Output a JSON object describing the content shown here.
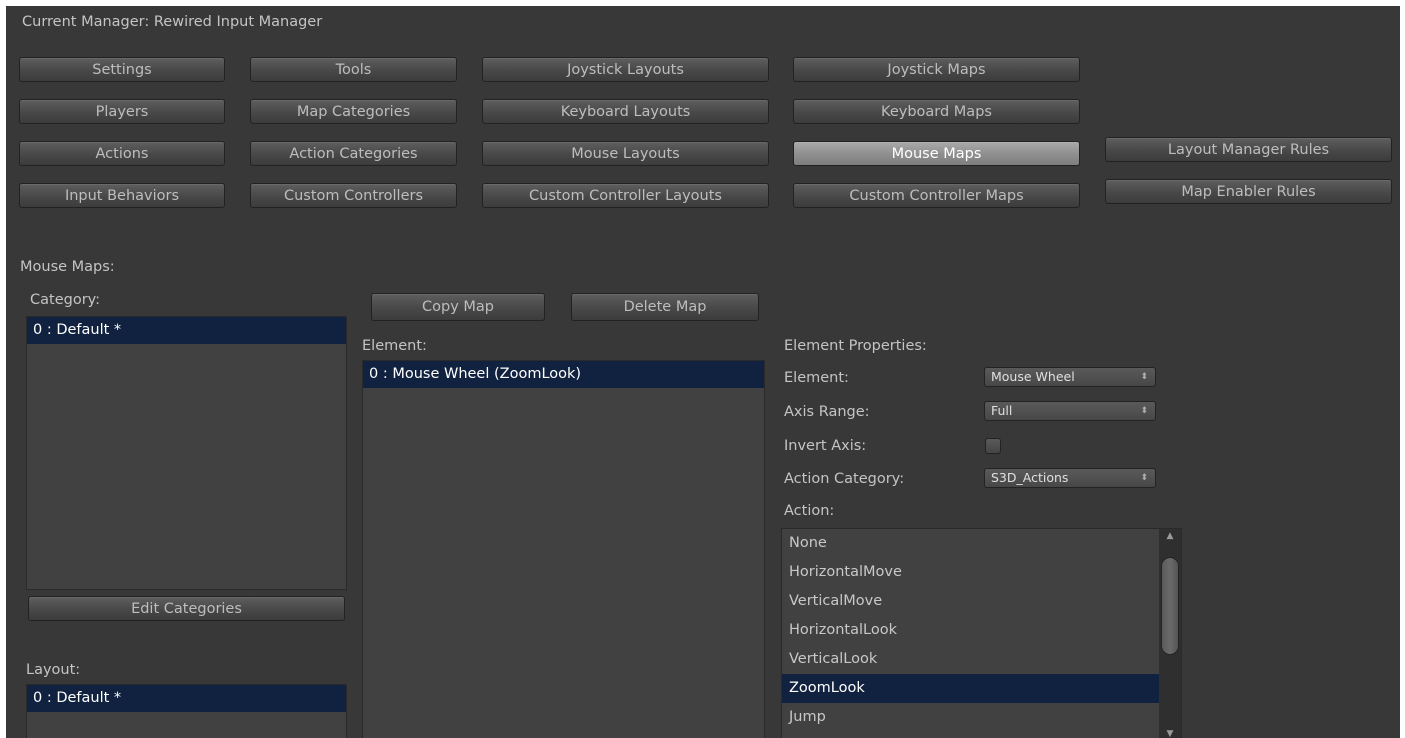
{
  "header": {
    "current_manager": "Current Manager: Rewired Input Manager"
  },
  "nav": {
    "settings": "Settings",
    "tools": "Tools",
    "joystick_layouts": "Joystick Layouts",
    "joystick_maps": "Joystick Maps",
    "players": "Players",
    "map_categories": "Map Categories",
    "keyboard_layouts": "Keyboard Layouts",
    "keyboard_maps": "Keyboard Maps",
    "actions": "Actions",
    "action_categories": "Action Categories",
    "mouse_layouts": "Mouse Layouts",
    "mouse_maps": "Mouse Maps",
    "layout_manager_rules": "Layout Manager Rules",
    "input_behaviors": "Input Behaviors",
    "custom_controllers": "Custom Controllers",
    "custom_controller_layouts": "Custom Controller Layouts",
    "custom_controller_maps": "Custom Controller Maps",
    "map_enabler_rules": "Map Enabler Rules"
  },
  "section_title": "Mouse Maps:",
  "category": {
    "label": "Category:",
    "items": [
      "0 : Default *"
    ],
    "edit_button": "Edit Categories"
  },
  "layout": {
    "label": "Layout:",
    "items": [
      "0 : Default *"
    ]
  },
  "map_buttons": {
    "copy": "Copy Map",
    "delete": "Delete Map"
  },
  "element": {
    "label": "Element:",
    "items": [
      "0 : Mouse Wheel  (ZoomLook)"
    ]
  },
  "properties": {
    "title": "Element Properties:",
    "element_label": "Element:",
    "element_value": "Mouse Wheel",
    "axis_range_label": "Axis Range:",
    "axis_range_value": "Full",
    "invert_axis_label": "Invert Axis:",
    "invert_axis_checked": false,
    "action_category_label": "Action Category:",
    "action_category_value": "S3D_Actions",
    "action_label": "Action:",
    "actions": [
      "None",
      "HorizontalMove",
      "VerticalMove",
      "HorizontalLook",
      "VerticalLook",
      "ZoomLook",
      "Jump"
    ],
    "selected_action": "ZoomLook"
  },
  "colors": {
    "panel": "#383838",
    "selection": "#10223f",
    "active_button": "#9a9a9a"
  }
}
